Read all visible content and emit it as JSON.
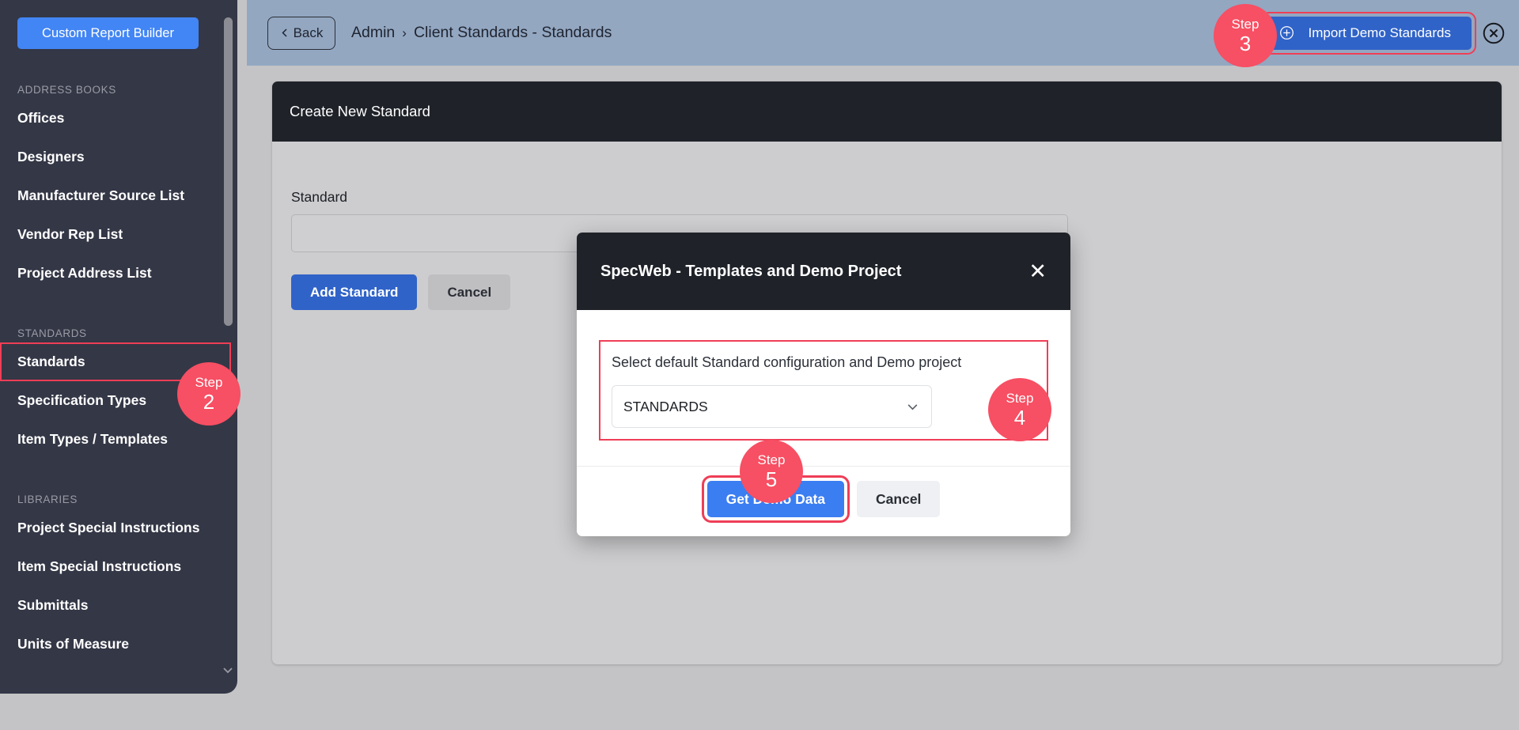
{
  "sidebar": {
    "custom_report_builder_label": "Custom Report Builder",
    "sections": [
      {
        "title": "ADDRESS BOOKS",
        "items": [
          {
            "label": "Offices"
          },
          {
            "label": "Designers"
          },
          {
            "label": "Manufacturer Source List"
          },
          {
            "label": "Vendor Rep List"
          },
          {
            "label": "Project Address List"
          }
        ]
      },
      {
        "title": "STANDARDS",
        "items": [
          {
            "label": "Standards"
          },
          {
            "label": "Specification Types"
          },
          {
            "label": "Item Types / Templates"
          }
        ]
      },
      {
        "title": "LIBRARIES",
        "items": [
          {
            "label": "Project Special Instructions"
          },
          {
            "label": "Item Special Instructions"
          },
          {
            "label": "Submittals"
          },
          {
            "label": "Units of Measure"
          }
        ]
      }
    ]
  },
  "topbar": {
    "back_label": "Back",
    "back_icon": "chevron-left-icon",
    "breadcrumb": {
      "root": "Admin",
      "separator": "›",
      "current": "Client Standards - Standards"
    },
    "import_button_label": "Import Demo Standards",
    "import_button_icon": "plus-circle-icon",
    "close_icon": "close-circle-icon"
  },
  "main": {
    "card_title": "Create New Standard",
    "standard_label": "Standard",
    "standard_value": "",
    "standard_placeholder": "",
    "add_button_label": "Add Standard",
    "cancel_button_label": "Cancel"
  },
  "modal": {
    "title": "SpecWeb - Templates and Demo Project",
    "close_icon": "close-icon",
    "close_glyph": "✕",
    "field_label": "Select default Standard configuration and Demo project",
    "select_value": "STANDARDS",
    "select_options": [
      "STANDARDS"
    ],
    "select_caret_icon": "chevron-down-icon",
    "primary_button_label": "Get Demo Data",
    "cancel_button_label": "Cancel"
  },
  "steps": [
    {
      "word": "Step",
      "number": "2"
    },
    {
      "word": "Step",
      "number": "3"
    },
    {
      "word": "Step",
      "number": "4"
    },
    {
      "word": "Step",
      "number": "5"
    }
  ],
  "colors": {
    "accent_blue": "#3063c8",
    "bright_blue": "#4285f4",
    "step_red": "#f74f63",
    "highlight_red": "#ef3e56",
    "sidebar_bg": "#343746",
    "header_bg": "#93a7c1",
    "dark_panel": "#1f2329",
    "page_bg": "#c4c4c6"
  }
}
